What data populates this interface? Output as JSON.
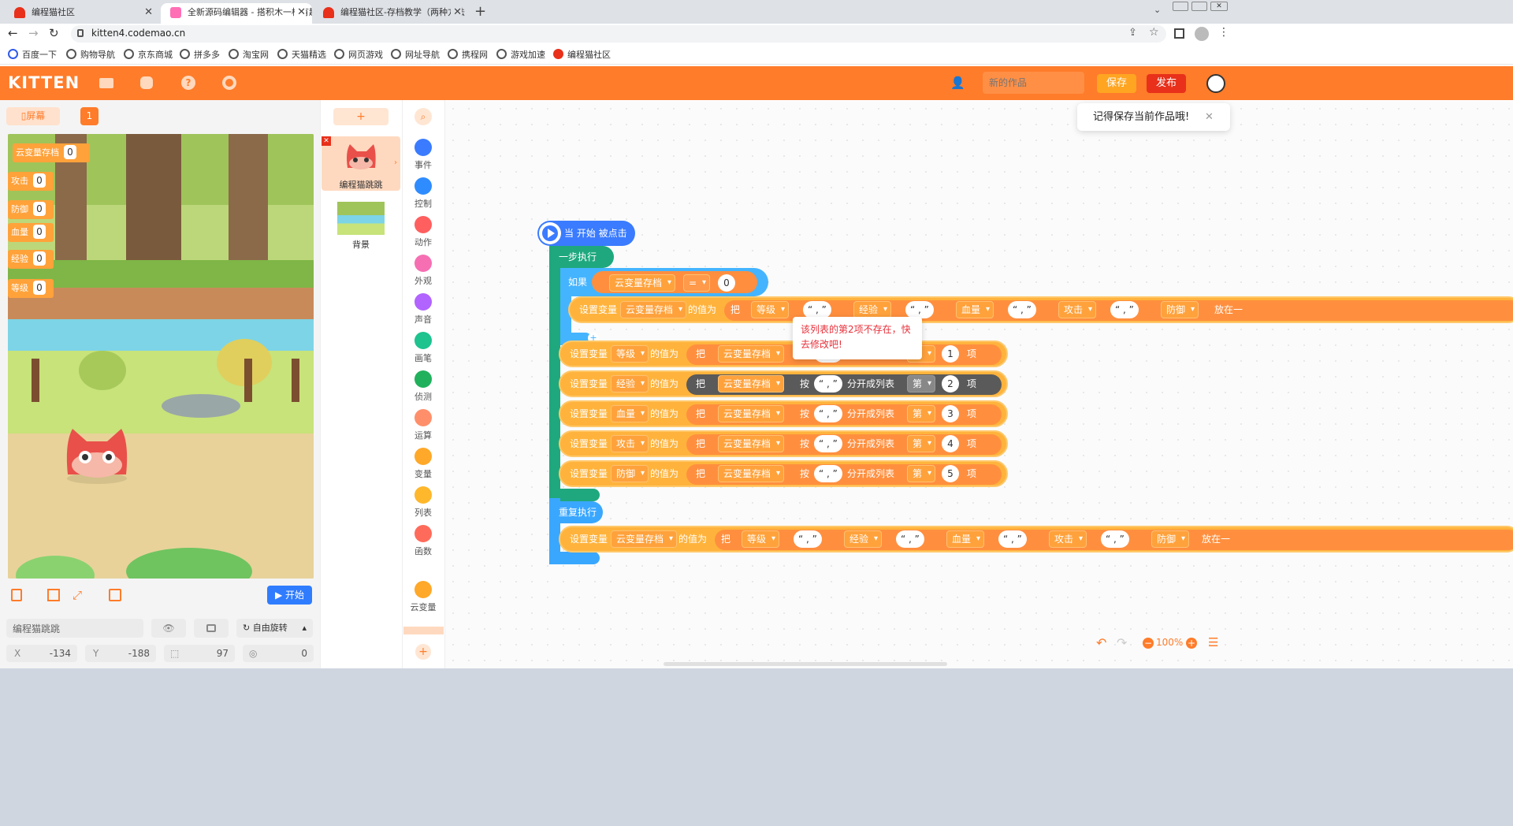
{
  "browser": {
    "tabs": [
      {
        "title": "编程猫社区"
      },
      {
        "title": "全新源码编辑器 - 搭积木一样有趣"
      },
      {
        "title": "编程猫社区-存档教学（两种方法"
      }
    ],
    "new_tab": "+",
    "url": "kitten4.codemao.cn",
    "bookmarks": [
      "百度一下",
      "购物导航",
      "京东商城",
      "拼多多",
      "淘宝网",
      "天猫精选",
      "网页游戏",
      "网址导航",
      "携程网",
      "游戏加速",
      "编程猫社区"
    ]
  },
  "app": {
    "logo": "KITTEN",
    "project_name_placeholder": "新的作品",
    "save_label": "保存",
    "publish_label": "发布",
    "toast": "记得保存当前作品哦!",
    "toast_close": "✕"
  },
  "stage": {
    "screen_label": "屏幕",
    "screen_num": "1",
    "vars": [
      {
        "name": "云变量存档",
        "value": "0"
      },
      {
        "name": "攻击",
        "value": "0"
      },
      {
        "name": "防御",
        "value": "0"
      },
      {
        "name": "血量",
        "value": "0"
      },
      {
        "name": "经验",
        "value": "0"
      },
      {
        "name": "等级",
        "value": "0"
      }
    ],
    "start_label": "▶ 开始",
    "sprite_name": "编程猫跳跳",
    "rotation_label": "自由旋转",
    "x_label": "X",
    "x_value": "-134",
    "y_label": "Y",
    "y_value": "-188",
    "size_value": "97",
    "dir_value": "0"
  },
  "sprites": {
    "add_label": "+",
    "items": [
      {
        "name": "编程猫跳跳"
      },
      {
        "name": "背景"
      }
    ]
  },
  "categories": [
    {
      "label": "事件",
      "color": "#3a7bff"
    },
    {
      "label": "控制",
      "color": "#2f8cff"
    },
    {
      "label": "动作",
      "color": "#ff5f5f"
    },
    {
      "label": "外观",
      "color": "#f66fb3"
    },
    {
      "label": "声音",
      "color": "#b164ff"
    },
    {
      "label": "画笔",
      "color": "#1ec38e"
    },
    {
      "label": "侦测",
      "color": "#21b15c"
    },
    {
      "label": "运算",
      "color": "#ff8f6b"
    },
    {
      "label": "变量",
      "color": "#ffa829"
    },
    {
      "label": "列表",
      "color": "#ffb72b"
    },
    {
      "label": "函数",
      "color": "#ff6b5a"
    },
    {
      "label": "云变量",
      "color": "#ffa829"
    }
  ],
  "workspace": {
    "hat": "当 开始 被点击",
    "step_exec": "一步执行",
    "if_label": "如果",
    "if_var": "云变量存档",
    "if_op": "=",
    "if_val": "0",
    "set_var": "设置变量",
    "value_of": "的值为",
    "join_ba": "把",
    "split_by": "按",
    "split_to_list": "分开成列表",
    "item_di": "第",
    "item_xiang": "项",
    "comma": "“ , ”",
    "put_in": "放在一",
    "set_cloud": {
      "target": "云变量存档",
      "parts": [
        "等级",
        "经验",
        "血量",
        "攻击",
        "防御"
      ]
    },
    "split_rows": [
      {
        "target": "等级",
        "src": "云变量存档",
        "index": "1"
      },
      {
        "target": "经验",
        "src": "云变量存档",
        "index": "2"
      },
      {
        "target": "血量",
        "src": "云变量存档",
        "index": "3"
      },
      {
        "target": "攻击",
        "src": "云变量存档",
        "index": "4"
      },
      {
        "target": "防御",
        "src": "云变量存档",
        "index": "5"
      }
    ],
    "repeat_label": "重复执行",
    "error_tip": "该列表的第2项不存在，快去修改吧!",
    "zoom": "100%"
  }
}
